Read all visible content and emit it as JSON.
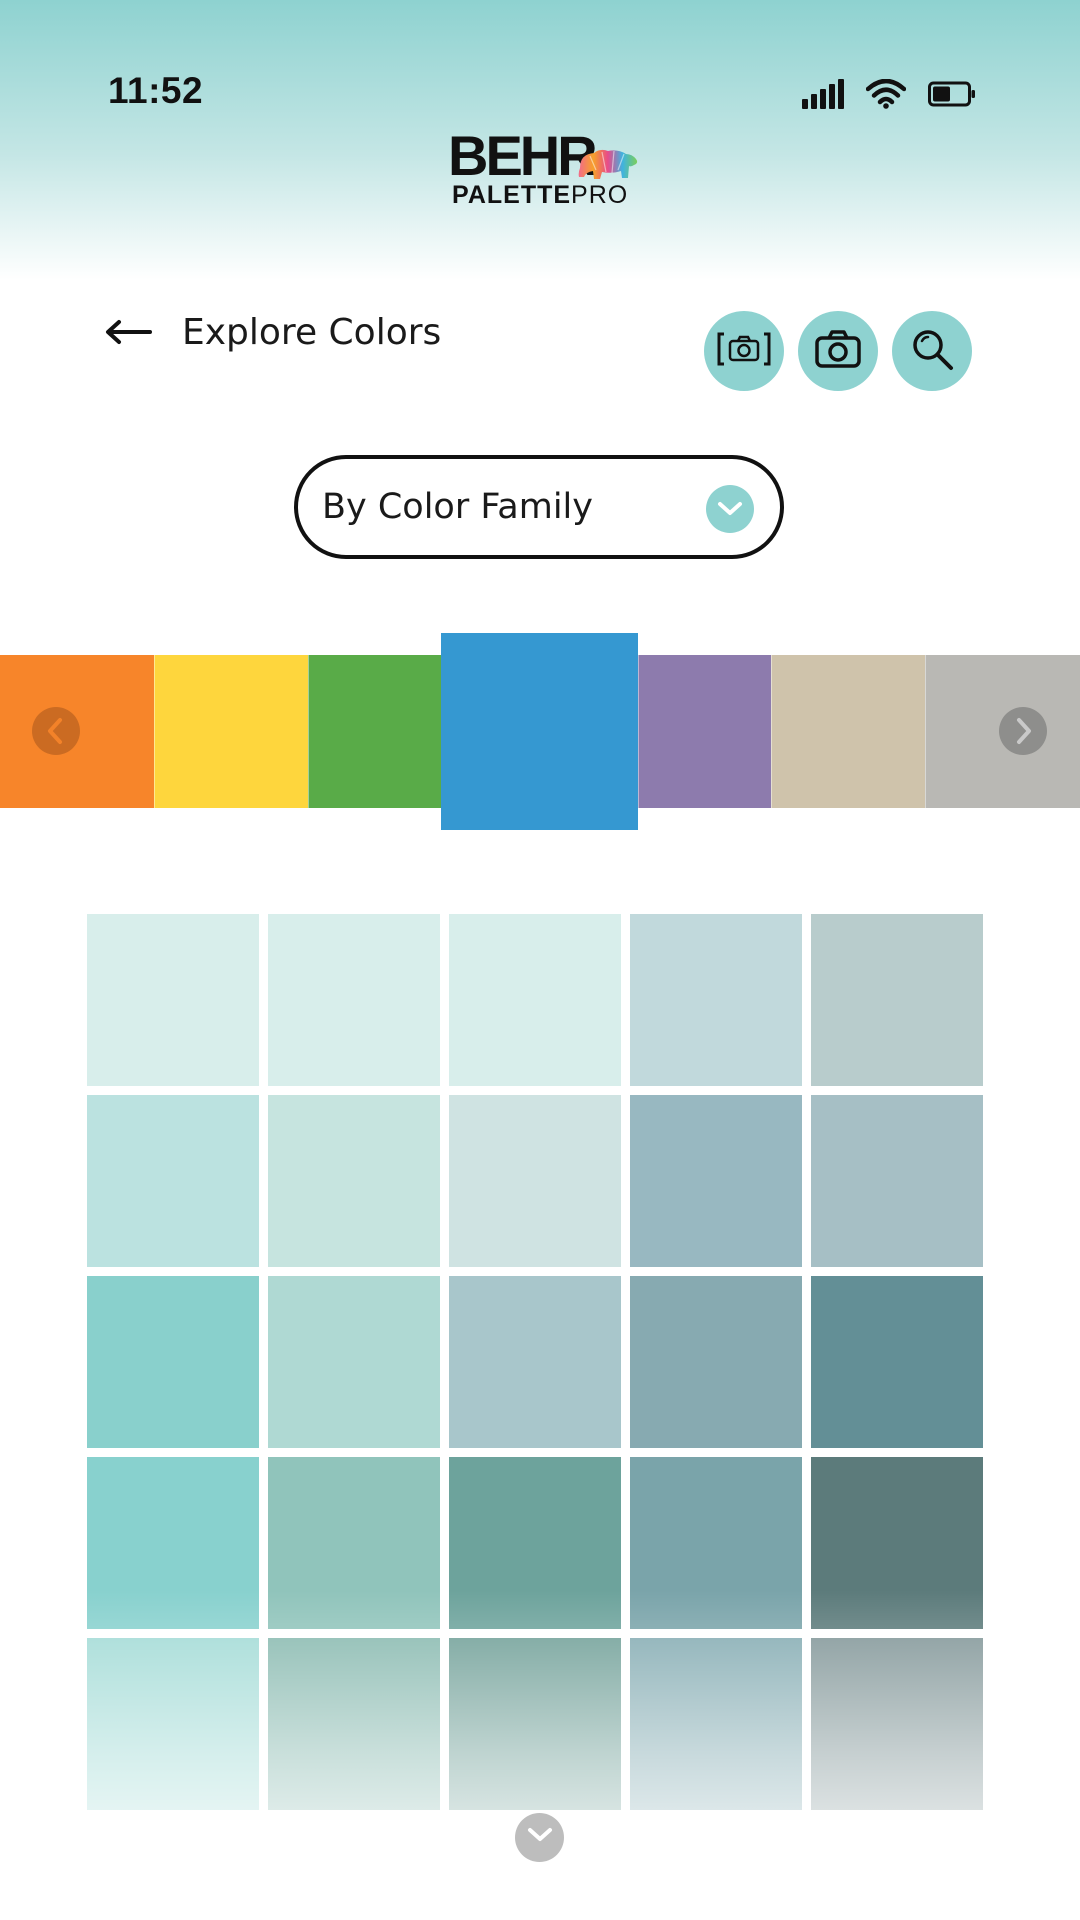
{
  "status_bar": {
    "time": "11:52",
    "icons": [
      "signal-icon",
      "wifi-icon",
      "battery-icon"
    ]
  },
  "logo": {
    "brand": "BEHR",
    "sub_bold": "PALETTE",
    "sub_regular": "PRO"
  },
  "toolbar": {
    "title": "Explore Colors",
    "actions": [
      "scan-icon",
      "camera-icon",
      "search-icon"
    ]
  },
  "filter": {
    "selected": "By Color Family"
  },
  "color_families": {
    "items": [
      {
        "color": "#f7852a"
      },
      {
        "color": "#fed63d"
      },
      {
        "color": "#59ab48"
      },
      {
        "color": "#3598d1",
        "selected": true
      },
      {
        "color": "#8d7bad"
      },
      {
        "color": "#cfc3ab"
      },
      {
        "color": "#b9b8b4"
      }
    ]
  },
  "swatch_grid": {
    "rows": [
      [
        "#d8eeeb",
        "#d8eeeb",
        "#d8eeeb",
        "#c1d9dc",
        "#b8cccc"
      ],
      [
        "#bbe2e0",
        "#c6e4df",
        "#cfe3e2",
        "#98b8c1",
        "#a6bfc5"
      ],
      [
        "#89d0cc",
        "#afd9d3",
        "#a8c6cb",
        "#87aab1",
        "#638f96"
      ],
      [
        "#88d1ce",
        "#90c4bb",
        "#6da39c",
        "#7aa4aa",
        "#5c7b7b"
      ],
      [
        "#a0dad5",
        "#86b8ae",
        "#6e9e96",
        "#82aab1",
        "#7f9496"
      ]
    ]
  },
  "colors": {
    "accent": "#8ed2d0",
    "header_top": "#8ed2d0"
  }
}
